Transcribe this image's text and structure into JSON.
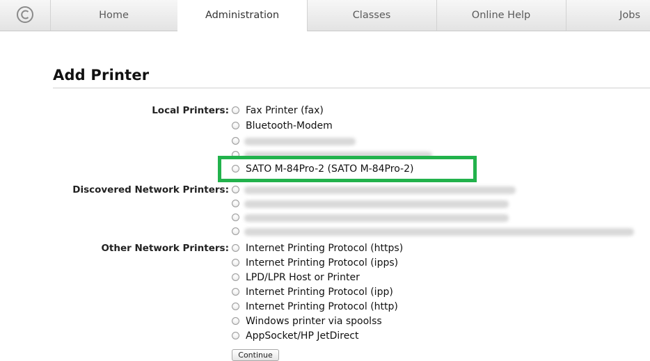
{
  "nav": {
    "tabs": [
      {
        "label": "Home"
      },
      {
        "label": "Administration",
        "active": true
      },
      {
        "label": "Classes"
      },
      {
        "label": "Online Help"
      },
      {
        "label": "Jobs"
      }
    ]
  },
  "page": {
    "title": "Add Printer"
  },
  "local_printers": {
    "label": "Local Printers:",
    "options": [
      {
        "label": "Fax Printer (fax)"
      },
      {
        "label": "Bluetooth-Modem"
      },
      {
        "label": ""
      },
      {
        "label": ""
      },
      {
        "label": "SATO M-84Pro-2 (SATO M-84Pro-2)",
        "highlighted": true
      }
    ]
  },
  "discovered_network_printers": {
    "label": "Discovered Network Printers:",
    "options": [
      {
        "label": ""
      },
      {
        "label": ""
      },
      {
        "label": ""
      },
      {
        "label": ""
      },
      {
        "label": ""
      }
    ]
  },
  "other_network_printers": {
    "label": "Other Network Printers:",
    "options": [
      {
        "label": "Internet Printing Protocol (https)"
      },
      {
        "label": "Internet Printing Protocol (ipps)"
      },
      {
        "label": "LPD/LPR Host or Printer"
      },
      {
        "label": "Internet Printing Protocol (ipp)"
      },
      {
        "label": "Internet Printing Protocol (http)"
      },
      {
        "label": "Windows printer via spoolss"
      },
      {
        "label": "AppSocket/HP JetDirect"
      }
    ]
  },
  "continue_label": "Continue",
  "colors": {
    "highlight_border": "#22b24c",
    "nav_background": "#e8e8e8"
  }
}
